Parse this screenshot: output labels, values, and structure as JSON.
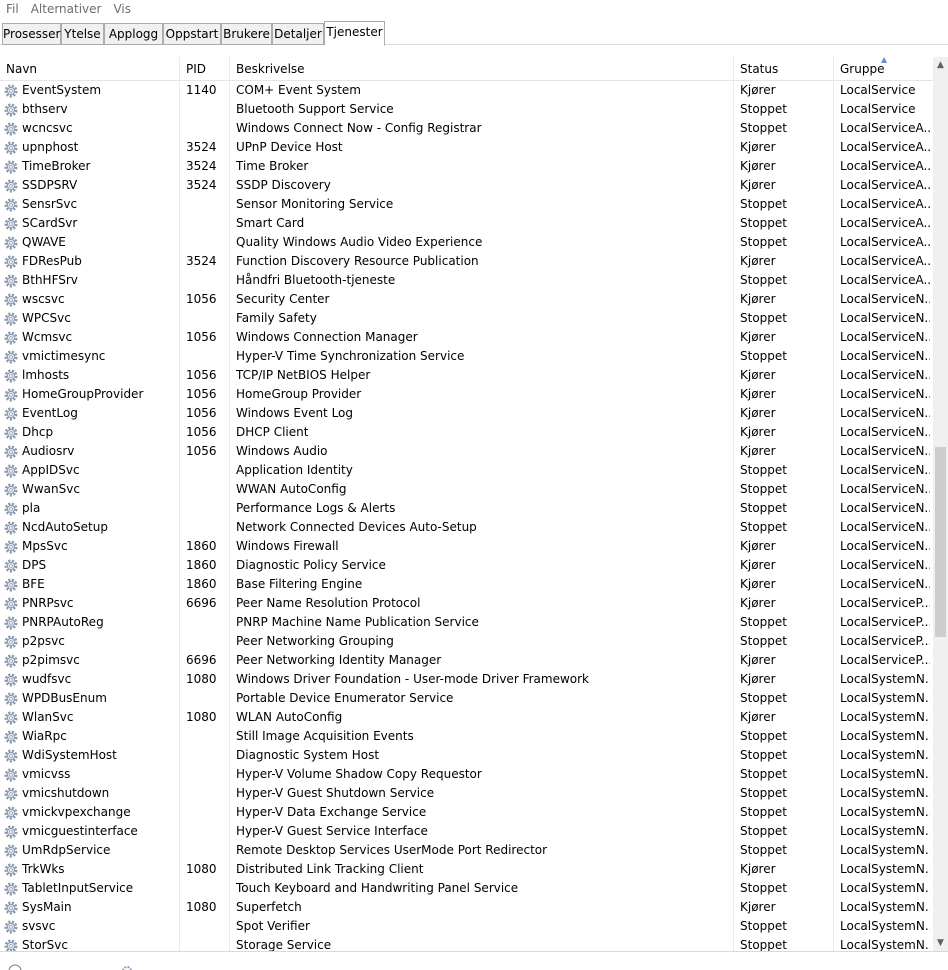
{
  "menu": [
    "Fil",
    "Alternativer",
    "Vis"
  ],
  "tabs": [
    {
      "label": "Prosesser"
    },
    {
      "label": "Ytelse"
    },
    {
      "label": "Applogg"
    },
    {
      "label": "Oppstart"
    },
    {
      "label": "Brukere"
    },
    {
      "label": "Detaljer"
    },
    {
      "label": "Tjenester",
      "active": true
    }
  ],
  "columns": {
    "name": "Navn",
    "pid": "PID",
    "description": "Beskrivelse",
    "status": "Status",
    "group": "Gruppe"
  },
  "sort": {
    "column": "Gruppe",
    "direction": "ascending"
  },
  "icon": "service-gear-icon",
  "services": [
    {
      "name": "EventSystem",
      "pid": "1140",
      "description": "COM+ Event System",
      "status": "Kjører",
      "group": "LocalService"
    },
    {
      "name": "bthserv",
      "pid": "",
      "description": "Bluetooth Support Service",
      "status": "Stoppet",
      "group": "LocalService"
    },
    {
      "name": "wcncsvc",
      "pid": "",
      "description": "Windows Connect Now - Config Registrar",
      "status": "Stoppet",
      "group": "LocalServiceA..."
    },
    {
      "name": "upnphost",
      "pid": "3524",
      "description": "UPnP Device Host",
      "status": "Kjører",
      "group": "LocalServiceA..."
    },
    {
      "name": "TimeBroker",
      "pid": "3524",
      "description": "Time Broker",
      "status": "Kjører",
      "group": "LocalServiceA..."
    },
    {
      "name": "SSDPSRV",
      "pid": "3524",
      "description": "SSDP Discovery",
      "status": "Kjører",
      "group": "LocalServiceA..."
    },
    {
      "name": "SensrSvc",
      "pid": "",
      "description": "Sensor Monitoring Service",
      "status": "Stoppet",
      "group": "LocalServiceA..."
    },
    {
      "name": "SCardSvr",
      "pid": "",
      "description": "Smart Card",
      "status": "Stoppet",
      "group": "LocalServiceA..."
    },
    {
      "name": "QWAVE",
      "pid": "",
      "description": "Quality Windows Audio Video Experience",
      "status": "Stoppet",
      "group": "LocalServiceA..."
    },
    {
      "name": "FDResPub",
      "pid": "3524",
      "description": "Function Discovery Resource Publication",
      "status": "Kjører",
      "group": "LocalServiceA..."
    },
    {
      "name": "BthHFSrv",
      "pid": "",
      "description": "Håndfri Bluetooth-tjeneste",
      "status": "Stoppet",
      "group": "LocalServiceA..."
    },
    {
      "name": "wscsvc",
      "pid": "1056",
      "description": "Security Center",
      "status": "Kjører",
      "group": "LocalServiceN..."
    },
    {
      "name": "WPCSvc",
      "pid": "",
      "description": "Family Safety",
      "status": "Stoppet",
      "group": "LocalServiceN..."
    },
    {
      "name": "Wcmsvc",
      "pid": "1056",
      "description": "Windows Connection Manager",
      "status": "Kjører",
      "group": "LocalServiceN..."
    },
    {
      "name": "vmictimesync",
      "pid": "",
      "description": "Hyper-V Time Synchronization Service",
      "status": "Stoppet",
      "group": "LocalServiceN..."
    },
    {
      "name": "lmhosts",
      "pid": "1056",
      "description": "TCP/IP NetBIOS Helper",
      "status": "Kjører",
      "group": "LocalServiceN..."
    },
    {
      "name": "HomeGroupProvider",
      "pid": "1056",
      "description": "HomeGroup Provider",
      "status": "Kjører",
      "group": "LocalServiceN..."
    },
    {
      "name": "EventLog",
      "pid": "1056",
      "description": "Windows Event Log",
      "status": "Kjører",
      "group": "LocalServiceN..."
    },
    {
      "name": "Dhcp",
      "pid": "1056",
      "description": "DHCP Client",
      "status": "Kjører",
      "group": "LocalServiceN..."
    },
    {
      "name": "Audiosrv",
      "pid": "1056",
      "description": "Windows Audio",
      "status": "Kjører",
      "group": "LocalServiceN..."
    },
    {
      "name": "AppIDSvc",
      "pid": "",
      "description": "Application Identity",
      "status": "Stoppet",
      "group": "LocalServiceN..."
    },
    {
      "name": "WwanSvc",
      "pid": "",
      "description": "WWAN AutoConfig",
      "status": "Stoppet",
      "group": "LocalServiceN..."
    },
    {
      "name": "pla",
      "pid": "",
      "description": "Performance Logs & Alerts",
      "status": "Stoppet",
      "group": "LocalServiceN..."
    },
    {
      "name": "NcdAutoSetup",
      "pid": "",
      "description": "Network Connected Devices Auto-Setup",
      "status": "Stoppet",
      "group": "LocalServiceN..."
    },
    {
      "name": "MpsSvc",
      "pid": "1860",
      "description": "Windows Firewall",
      "status": "Kjører",
      "group": "LocalServiceN..."
    },
    {
      "name": "DPS",
      "pid": "1860",
      "description": "Diagnostic Policy Service",
      "status": "Kjører",
      "group": "LocalServiceN..."
    },
    {
      "name": "BFE",
      "pid": "1860",
      "description": "Base Filtering Engine",
      "status": "Kjører",
      "group": "LocalServiceN..."
    },
    {
      "name": "PNRPsvc",
      "pid": "6696",
      "description": "Peer Name Resolution Protocol",
      "status": "Kjører",
      "group": "LocalServiceP..."
    },
    {
      "name": "PNRPAutoReg",
      "pid": "",
      "description": "PNRP Machine Name Publication Service",
      "status": "Stoppet",
      "group": "LocalServiceP..."
    },
    {
      "name": "p2psvc",
      "pid": "",
      "description": "Peer Networking Grouping",
      "status": "Stoppet",
      "group": "LocalServiceP..."
    },
    {
      "name": "p2pimsvc",
      "pid": "6696",
      "description": "Peer Networking Identity Manager",
      "status": "Kjører",
      "group": "LocalServiceP..."
    },
    {
      "name": "wudfsvc",
      "pid": "1080",
      "description": "Windows Driver Foundation - User-mode Driver Framework",
      "status": "Kjører",
      "group": "LocalSystemN..."
    },
    {
      "name": "WPDBusEnum",
      "pid": "",
      "description": "Portable Device Enumerator Service",
      "status": "Stoppet",
      "group": "LocalSystemN..."
    },
    {
      "name": "WlanSvc",
      "pid": "1080",
      "description": "WLAN AutoConfig",
      "status": "Kjører",
      "group": "LocalSystemN..."
    },
    {
      "name": "WiaRpc",
      "pid": "",
      "description": "Still Image Acquisition Events",
      "status": "Stoppet",
      "group": "LocalSystemN..."
    },
    {
      "name": "WdiSystemHost",
      "pid": "",
      "description": "Diagnostic System Host",
      "status": "Stoppet",
      "group": "LocalSystemN..."
    },
    {
      "name": "vmicvss",
      "pid": "",
      "description": "Hyper-V Volume Shadow Copy Requestor",
      "status": "Stoppet",
      "group": "LocalSystemN..."
    },
    {
      "name": "vmicshutdown",
      "pid": "",
      "description": "Hyper-V Guest Shutdown Service",
      "status": "Stoppet",
      "group": "LocalSystemN..."
    },
    {
      "name": "vmickvpexchange",
      "pid": "",
      "description": "Hyper-V Data Exchange Service",
      "status": "Stoppet",
      "group": "LocalSystemN..."
    },
    {
      "name": "vmicguestinterface",
      "pid": "",
      "description": "Hyper-V Guest Service Interface",
      "status": "Stoppet",
      "group": "LocalSystemN..."
    },
    {
      "name": "UmRdpService",
      "pid": "",
      "description": "Remote Desktop Services UserMode Port Redirector",
      "status": "Stoppet",
      "group": "LocalSystemN..."
    },
    {
      "name": "TrkWks",
      "pid": "1080",
      "description": "Distributed Link Tracking Client",
      "status": "Kjører",
      "group": "LocalSystemN..."
    },
    {
      "name": "TabletInputService",
      "pid": "",
      "description": "Touch Keyboard and Handwriting Panel Service",
      "status": "Stoppet",
      "group": "LocalSystemN..."
    },
    {
      "name": "SysMain",
      "pid": "1080",
      "description": "Superfetch",
      "status": "Kjører",
      "group": "LocalSystemN..."
    },
    {
      "name": "svsvc",
      "pid": "",
      "description": "Spot Verifier",
      "status": "Stoppet",
      "group": "LocalSystemN..."
    },
    {
      "name": "StorSvc",
      "pid": "",
      "description": "Storage Service",
      "status": "Stoppet",
      "group": "LocalSystemN..."
    }
  ],
  "scroll": {
    "position": 0.5
  },
  "colors": {
    "accent": "#6a8fc8",
    "menu_text": "#6d6d6d",
    "gear": "#7a8aa0"
  }
}
